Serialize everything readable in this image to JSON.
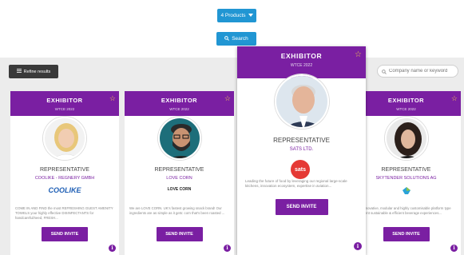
{
  "toolbar": {
    "products_label": "4 Products",
    "search_label": "Search",
    "refine_label": "Refine results",
    "company_search_placeholder": "Company name or keyword"
  },
  "cards": [
    {
      "header": "EXHIBITOR",
      "sub": "WTCE 2022",
      "role": "REPRESENTATIVE",
      "company": "COOLIKE - REGNERY GMBH",
      "logo_text": "COOLIKE",
      "desc": "COME IN AND FIND the most REFRESHING GUEST AMENITY TOWELS your highly effective DISINFECTANTS for handcareful/need, FRESH...",
      "invite": "SEND INVITE"
    },
    {
      "header": "EXHIBITOR",
      "sub": "WTCE 2022",
      "role": "REPRESENTATIVE",
      "company": "LOVE CORN",
      "logo_text": "LOVE CORN",
      "desc": "We are LOVE CORN. UK's fastest growing snack brand! Our ingredients are as simple as it gets: corn that's been roasted ...",
      "invite": "SEND INVITE"
    },
    {
      "header": "EXHIBITOR",
      "sub": "WTCE 2022",
      "role": "REPRESENTATIVE",
      "company": "SATS LTD.",
      "logo_text": "sats",
      "desc": "Leading the future of food by leveraging our regional large-scale kitchens, innovation ecosystem, expertise in aviation...",
      "invite": "SEND INVITE"
    },
    {
      "header": "EXHIBITOR",
      "sub": "WTCE 2022",
      "role": "REPRESENTATIVE",
      "company": "SKYTENDER SOLUTIONS AG",
      "logo_text": "",
      "desc": "Our innovative, modular and highly customisable platform type excellent sustainable & efficient beverage experiences...",
      "invite": "SEND INVITE"
    }
  ],
  "colors": {
    "accent": "#7a1fa2",
    "primary_button": "#2196d3",
    "star": "#f2c94c"
  },
  "icons": [
    "chevron-down-icon",
    "search-icon",
    "filter-icon",
    "star-icon",
    "info-icon"
  ]
}
